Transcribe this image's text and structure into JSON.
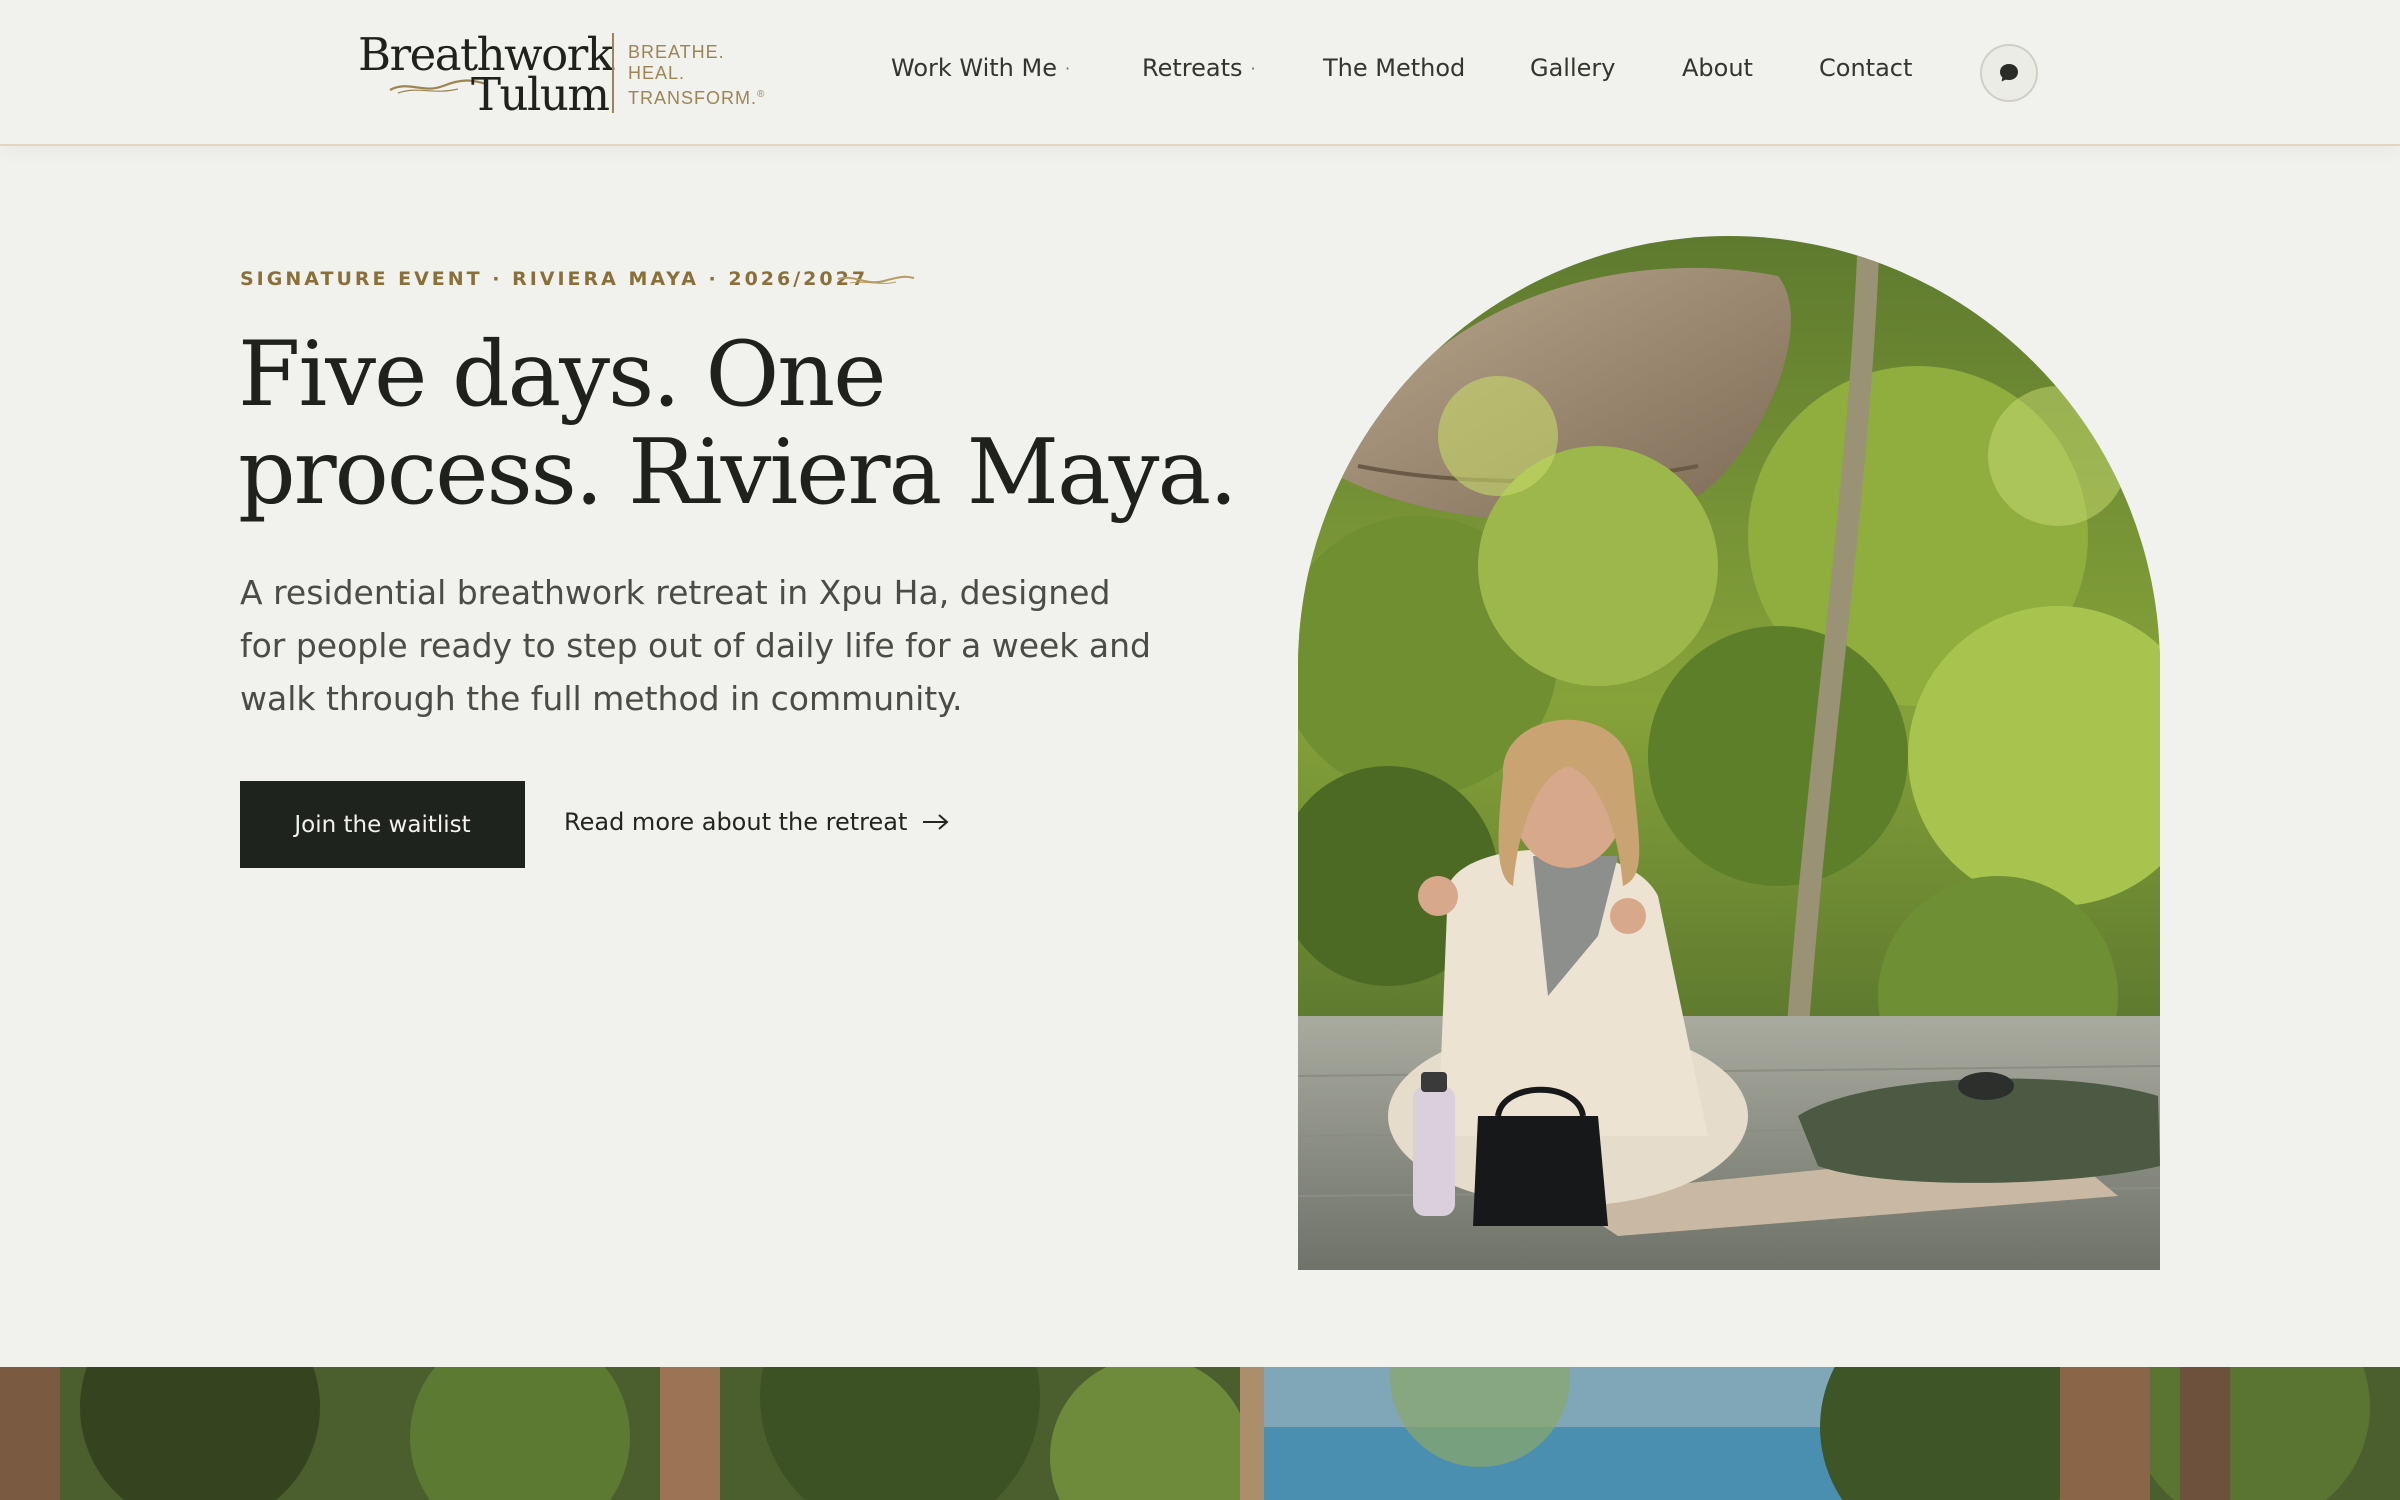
{
  "brand": {
    "name_line1": "Breathwork",
    "name_line2": "Tulum",
    "tagline": [
      "BREATHE.",
      "HEAL.",
      "TRANSFORM."
    ],
    "registered_mark": "®",
    "color": "#9c8553"
  },
  "nav": {
    "items": [
      {
        "label": "Work With Me",
        "has_dropdown": true
      },
      {
        "label": "Retreats",
        "has_dropdown": true
      },
      {
        "label": "The Method",
        "has_dropdown": false
      },
      {
        "label": "Gallery",
        "has_dropdown": false
      },
      {
        "label": "About",
        "has_dropdown": false
      },
      {
        "label": "Contact",
        "has_dropdown": false
      }
    ],
    "dropdown_marker": "·",
    "chat_icon": "chat-bubble-icon"
  },
  "hero": {
    "eyebrow": "SIGNATURE EVENT · RIVIERA MAYA · 2026/2027",
    "headline_line1": "Five days. One",
    "headline_line2": "process. Riviera Maya.",
    "lede": "A residential breathwork retreat in Xpu Ha, designed for people ready to step out of daily life for a week and walk through the full method in community.",
    "primary_cta": "Join the waitlist",
    "secondary_cta": "Read more about the retreat",
    "secondary_icon": "arrow-right-icon"
  },
  "colors": {
    "background": "#f1f1ed",
    "accent_gold": "#8a6f38",
    "text_dark": "#1f211d",
    "button_dark": "#1f231e"
  }
}
